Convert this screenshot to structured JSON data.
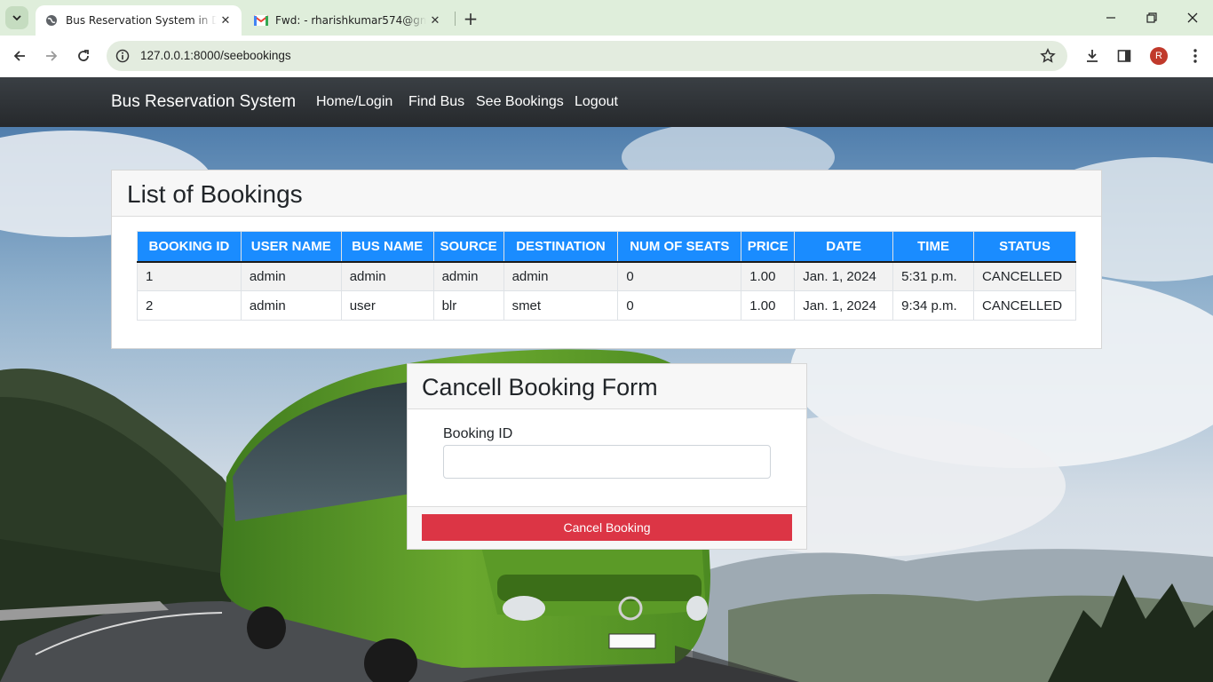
{
  "browser": {
    "tabs": [
      {
        "title": "Bus Reservation System in Djan",
        "active": true
      },
      {
        "title": "Fwd: - rharishkumar574@gmail",
        "active": false
      }
    ],
    "url": "127.0.0.1:8000/seebookings",
    "profile_initial": "R"
  },
  "navbar": {
    "brand": "Bus Reservation System",
    "links": [
      "Home/Login",
      "Find Bus",
      "See Bookings",
      "Logout"
    ]
  },
  "bookings": {
    "title": "List of Bookings",
    "columns": [
      "BOOKING ID",
      "USER NAME",
      "BUS NAME",
      "SOURCE",
      "DESTINATION",
      "NUM OF SEATS",
      "PRICE",
      "DATE",
      "TIME",
      "STATUS"
    ],
    "rows": [
      [
        "1",
        "admin",
        "admin",
        "admin",
        "admin",
        "0",
        "1.00",
        "Jan. 1, 2024",
        "5:31 p.m.",
        "CANCELLED"
      ],
      [
        "2",
        "admin",
        "user",
        "blr",
        "smet",
        "0",
        "1.00",
        "Jan. 1, 2024",
        "9:34 p.m.",
        "CANCELLED"
      ]
    ]
  },
  "cancel_form": {
    "title": "Cancell Booking Form",
    "field_label": "Booking ID",
    "field_value": "",
    "submit_label": "Cancel Booking"
  },
  "colors": {
    "table_header": "#1a8cff",
    "cancel_button": "#dc3545",
    "navbar": "#2d3135",
    "tabstrip": "#dfeedb"
  }
}
